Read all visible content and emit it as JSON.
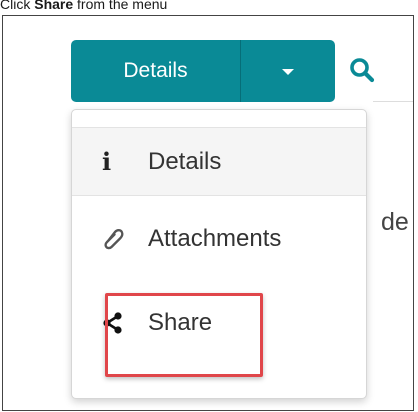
{
  "caption": {
    "prefix": "Click ",
    "bold": "Share",
    "suffix": " from the menu"
  },
  "toolbar": {
    "primary_label": "Details",
    "dropdown_icon": "caret-down-icon",
    "search_icon": "search-icon",
    "accent_color": "#0a8a96"
  },
  "background": {
    "partial_text": "de"
  },
  "menu": {
    "items": [
      {
        "label": "Details",
        "icon": "info-icon"
      },
      {
        "label": "Attachments",
        "icon": "paperclip-icon"
      },
      {
        "label": "Share",
        "icon": "share-icon"
      }
    ]
  },
  "highlight": {
    "color": "#e0464a"
  }
}
